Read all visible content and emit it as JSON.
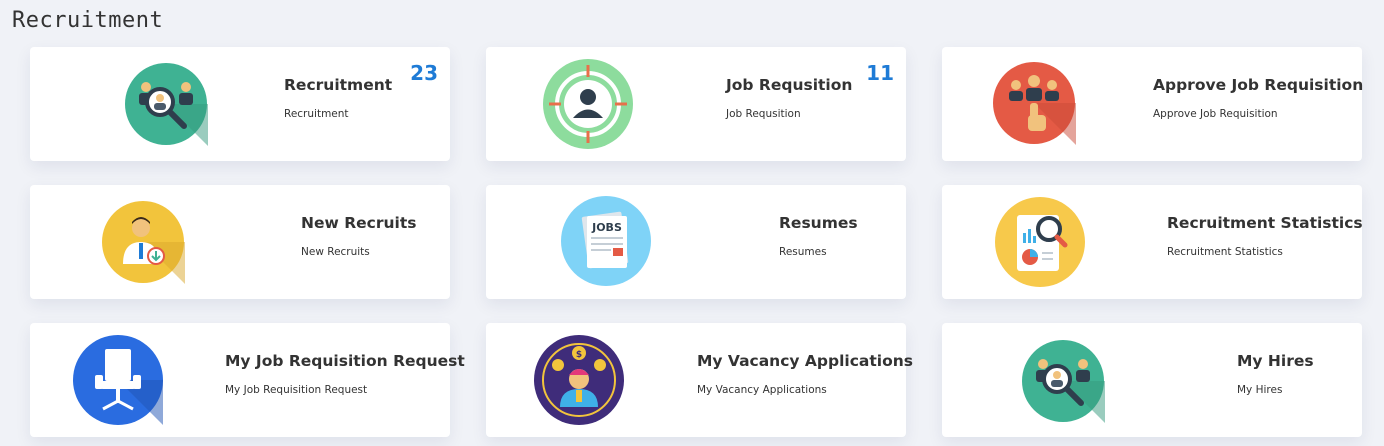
{
  "page": {
    "title": "Recruitment"
  },
  "cards": [
    {
      "title": "Recruitment",
      "subtitle": "Recruitment",
      "count": "23",
      "icon": "recruitment-search-icon",
      "color": "#3fb293"
    },
    {
      "title": "Job Requsition",
      "subtitle": "Job Requsition",
      "count": "11",
      "icon": "target-person-icon",
      "color": "#8ddc9d"
    },
    {
      "title": "Approve Job Requisition",
      "subtitle": "Approve Job Requisition",
      "count": "",
      "icon": "hand-select-person-icon",
      "color": "#e45a45"
    },
    {
      "title": "New Recruits",
      "subtitle": "New Recruits",
      "count": "",
      "icon": "new-recruit-icon",
      "color": "#f2c43c"
    },
    {
      "title": "Resumes",
      "subtitle": "Resumes",
      "count": "",
      "icon": "jobs-document-icon",
      "color": "#7fd3f7",
      "icon_text": "JOBS"
    },
    {
      "title": "Recruitment Statistics",
      "subtitle": "Recruitment Statistics",
      "count": "",
      "icon": "statistics-report-icon",
      "color": "#f7c94b"
    },
    {
      "title": "My Job Requisition Request",
      "subtitle": "My Job Requisition Request",
      "count": "",
      "icon": "office-chair-icon",
      "color": "#2a6ce0"
    },
    {
      "title": "My Vacancy Applications",
      "subtitle": "My Vacancy Applications",
      "count": "",
      "icon": "applicant-icon",
      "color": "#3f2c7a",
      "icon_text": "$"
    },
    {
      "title": "My Hires",
      "subtitle": "My Hires",
      "count": "",
      "icon": "hires-search-icon",
      "color": "#3fb293"
    }
  ]
}
